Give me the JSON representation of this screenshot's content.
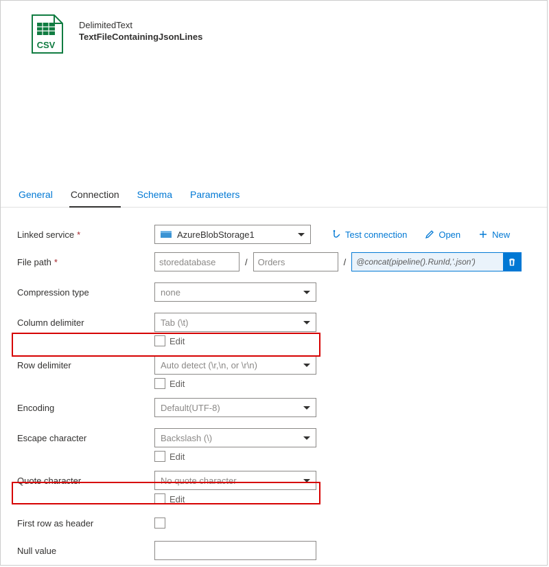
{
  "header": {
    "type": "DelimitedText",
    "name": "TextFileContainingJsonLines",
    "badge": "CSV"
  },
  "tabs": {
    "general": "General",
    "connection": "Connection",
    "schema": "Schema",
    "parameters": "Parameters"
  },
  "actions": {
    "test": "Test connection",
    "open": "Open",
    "new": "New"
  },
  "form": {
    "linked_label": "Linked service",
    "linked_value": "AzureBlobStorage1",
    "file_label": "File path",
    "path_container": "storedatabase",
    "path_dir": "Orders",
    "path_file": "@concat(pipeline().RunId,'.json')",
    "compression_label": "Compression type",
    "compression_value": "none",
    "coldelim_label": "Column delimiter",
    "coldelim_value": "Tab (\\t)",
    "rowdelim_label": "Row delimiter",
    "rowdelim_value": "Auto detect (\\r,\\n, or \\r\\n)",
    "encoding_label": "Encoding",
    "encoding_value": "Default(UTF-8)",
    "escape_label": "Escape character",
    "escape_value": "Backslash (\\)",
    "quote_label": "Quote character",
    "quote_value": "No quote character",
    "firstrow_label": "First row as header",
    "null_label": "Null value",
    "edit": "Edit"
  }
}
